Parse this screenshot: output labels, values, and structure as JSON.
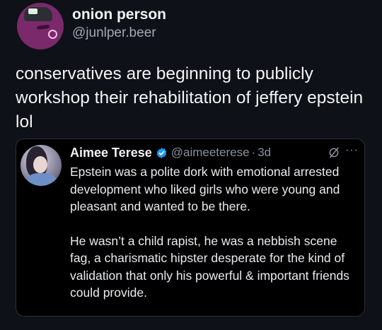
{
  "post": {
    "author": {
      "display_name": "onion person",
      "handle": "@junlper.beer"
    },
    "text": "conservatives are beginning to publicly workshop their rehabilitation of jeffery epstein lol"
  },
  "quoted_post": {
    "author": {
      "display_name": "Aimee Terese",
      "handle": "@aimeeterese",
      "verified": true
    },
    "separator": "·",
    "time": "3d",
    "more_icon": "···",
    "paragraphs": [
      "Epstein was a polite dork with emotional arrested development who liked girls who were young and pleasant and wanted to be there.",
      "He wasn’t a child rapist, he was a nebbish scene fag, a charismatic hipster desperate for the kind of validation that only his powerful & important friends could provide."
    ]
  },
  "icons": {
    "author_avatar": "onion-avatar-icon",
    "quote_avatar": "profile-photo",
    "verified": "verified-badge-icon",
    "grok": "grok-icon",
    "more": "more-options-icon"
  },
  "colors": {
    "background": "#0e1117",
    "card_background": "#000000",
    "verified_blue": "#1d9bf0",
    "muted_text": "#8b919b"
  }
}
